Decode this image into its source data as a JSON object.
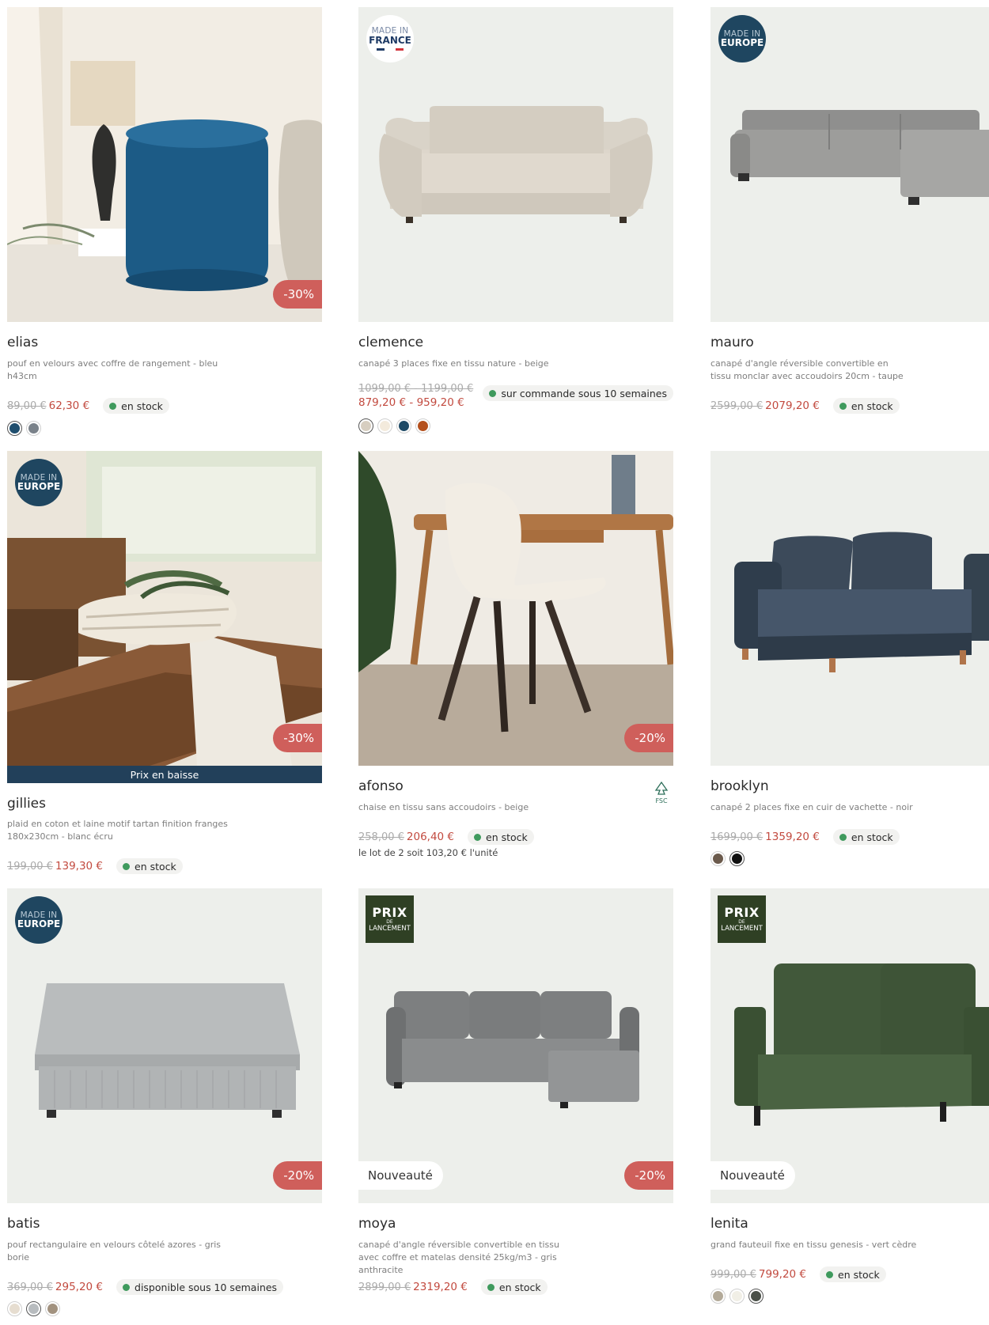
{
  "products": [
    {
      "name": "elias",
      "description": "pouf en velours avec coffre de rangement - bleu h43cm",
      "old_price": "89,00 €",
      "new_price": "62,30 €",
      "stock": "en stock",
      "discount": "-30%",
      "swatches": [
        "#1f4e6e",
        "#7a828a"
      ]
    },
    {
      "name": "clemence",
      "badge_line1": "MADE IN",
      "badge_line2": "FRANCE",
      "description": "canapé 3 places fixe en tissu nature - beige",
      "old_price": "1099,00 € - 1199,00 €",
      "new_price": "879,20 € - 959,20 €",
      "stock": "sur commande sous 10 semaines",
      "swatches": [
        "#d7cec0",
        "#f3eadc",
        "#1e4a66",
        "#b4501c"
      ]
    },
    {
      "name": "mauro",
      "badge_line1": "MADE IN",
      "badge_line2": "EUROPE",
      "description": "canapé d'angle réversible convertible en tissu monclar avec accoudoirs 20cm - taupe",
      "old_price": "2599,00 €",
      "new_price": "2079,20 €",
      "stock": "en stock"
    },
    {
      "name": "gillies",
      "badge_line1": "MADE IN",
      "badge_line2": "EUROPE",
      "strip": "Prix en baisse",
      "description": "plaid en coton et laine motif tartan finition franges 180x230cm - blanc écru",
      "old_price": "199,00 €",
      "new_price": "139,30 €",
      "stock": "en stock",
      "discount": "-30%"
    },
    {
      "name": "afonso",
      "fsc_label": "FSC",
      "description": "chaise en tissu sans accoudoirs - beige",
      "old_price": "258,00 €",
      "new_price": "206,40 €",
      "stock": "en stock",
      "note": "le lot de 2 soit 103,20 € l'unité",
      "discount": "-20%"
    },
    {
      "name": "brooklyn",
      "description": "canapé 2 places fixe en cuir de vachette - noir",
      "old_price": "1699,00 €",
      "new_price": "1359,20 €",
      "stock": "en stock",
      "swatches": [
        "#6b5a4c",
        "#111111"
      ]
    },
    {
      "name": "batis",
      "badge_line1": "MADE IN",
      "badge_line2": "EUROPE",
      "description": "pouf rectangulaire en velours côtelé azores - gris borie",
      "old_price": "369,00 €",
      "new_price": "295,20 €",
      "stock": "disponible sous 10 semaines",
      "discount": "-20%",
      "swatches": [
        "#e6ddd0",
        "#b8bcbf",
        "#a2927f"
      ]
    },
    {
      "name": "moya",
      "prix_line1": "PRIX",
      "prix_line2": "DE",
      "prix_line3": "LANCEMENT",
      "label": "Nouveauté",
      "description": "canapé d'angle réversible convertible en tissu avec coffre et matelas densité 25kg/m3 - gris anthracite",
      "old_price": "2899,00 €",
      "new_price": "2319,20 €",
      "stock": "en stock",
      "discount": "-20%"
    },
    {
      "name": "lenita",
      "prix_line1": "PRIX",
      "prix_line2": "DE",
      "prix_line3": "LANCEMENT",
      "label": "Nouveauté",
      "description": "grand fauteuil fixe en tissu genesis - vert cèdre",
      "old_price": "999,00 €",
      "new_price": "799,20 €",
      "stock": "en stock",
      "swatches": [
        "#b3aa99",
        "#f1efe6",
        "#4a5048"
      ]
    }
  ],
  "colors": {
    "discount": "#cf5f5b",
    "price": "#c24a3f",
    "stock_dot": "#3f9a5d",
    "europe_badge": "#1f4660",
    "prix_badge": "#2f4024"
  }
}
